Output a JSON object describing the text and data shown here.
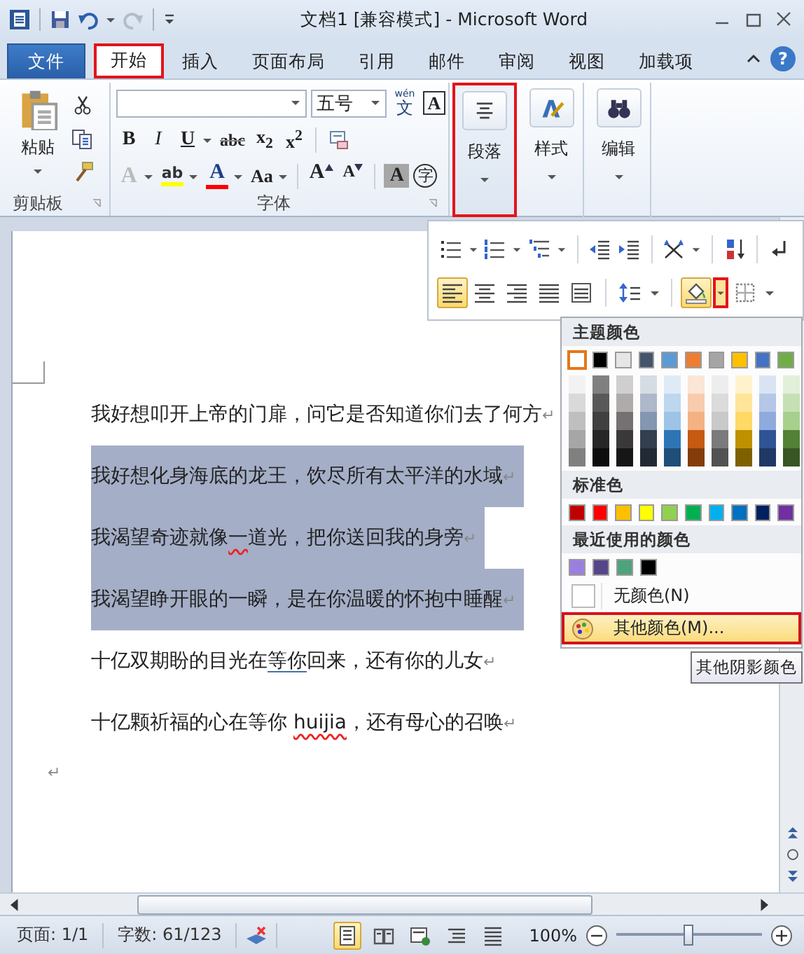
{
  "title_bar": {
    "title": "文档1 [兼容模式] - Microsoft Word",
    "redo_disabled": true
  },
  "tabs": [
    {
      "label": "文件",
      "kind": "file",
      "selected": false,
      "highlighted": false
    },
    {
      "label": "开始",
      "kind": "tab",
      "selected": true,
      "highlighted": true
    },
    {
      "label": "插入",
      "kind": "tab",
      "selected": false,
      "highlighted": false
    },
    {
      "label": "页面布局",
      "kind": "tab",
      "selected": false,
      "highlighted": false
    },
    {
      "label": "引用",
      "kind": "tab",
      "selected": false,
      "highlighted": false
    },
    {
      "label": "邮件",
      "kind": "tab",
      "selected": false,
      "highlighted": false
    },
    {
      "label": "审阅",
      "kind": "tab",
      "selected": false,
      "highlighted": false
    },
    {
      "label": "视图",
      "kind": "tab",
      "selected": false,
      "highlighted": false
    },
    {
      "label": "加载项",
      "kind": "tab",
      "selected": false,
      "highlighted": false
    }
  ],
  "help": "?",
  "ribbon": {
    "clipboard": {
      "paste_label": "粘贴",
      "group_label": "剪贴板"
    },
    "font": {
      "font_size": "五号",
      "phonetic_ruby": "wén",
      "phonetic_char": "文",
      "border_char": "A",
      "group_label": "字体",
      "format_buttons": [
        {
          "label": "B",
          "kind": "bold"
        },
        {
          "label": "I",
          "kind": "italic"
        },
        {
          "label": "U",
          "kind": "underline",
          "dropdown": true
        },
        {
          "label": "abc",
          "kind": "strikethrough"
        },
        {
          "label": "x$_{2}$",
          "kind": "subscript"
        },
        {
          "label": "x$^{2}$",
          "kind": "superscript"
        },
        {
          "kind": "separator"
        },
        {
          "kind": "clear-format"
        }
      ],
      "style_buttons": [
        {
          "label": "A",
          "kind": "text-effects",
          "dropdown": true
        },
        {
          "label": "ab",
          "kind": "highlight",
          "dropdown": true,
          "color": "#ffff00"
        },
        {
          "label": "A",
          "kind": "font-color",
          "dropdown": true,
          "color": "#ff0000"
        },
        {
          "label": "Aa",
          "kind": "change-case",
          "dropdown": true
        },
        {
          "kind": "separator"
        },
        {
          "label": "A",
          "kind": "grow-font"
        },
        {
          "label": "A",
          "kind": "shrink-font"
        },
        {
          "kind": "separator"
        },
        {
          "label": "A",
          "kind": "char-shading"
        },
        {
          "label": "字",
          "kind": "enclose"
        }
      ]
    },
    "groups": [
      {
        "label": "段落",
        "kind": "paragraph",
        "highlighted": true
      },
      {
        "label": "样式",
        "kind": "styles",
        "highlighted": false
      },
      {
        "label": "编辑",
        "kind": "editing",
        "highlighted": false
      }
    ]
  },
  "paragraph_panel": {
    "rows": [
      [
        {
          "kind": "bullets",
          "dropdown": true,
          "selected": false
        },
        {
          "kind": "numbering",
          "dropdown": true,
          "selected": false
        },
        {
          "kind": "multilevel",
          "dropdown": true,
          "selected": false
        },
        {
          "kind": "separator"
        },
        {
          "kind": "decrease-indent",
          "selected": false
        },
        {
          "kind": "increase-indent",
          "selected": false
        },
        {
          "kind": "separator"
        },
        {
          "kind": "asian-layout",
          "dropdown": true,
          "selected": false
        },
        {
          "kind": "separator"
        },
        {
          "kind": "sort",
          "selected": false
        },
        {
          "kind": "separator"
        },
        {
          "kind": "show-marks",
          "selected": false
        }
      ],
      [
        {
          "kind": "align-left",
          "selected": true
        },
        {
          "kind": "align-center",
          "selected": false
        },
        {
          "kind": "align-right",
          "selected": false
        },
        {
          "kind": "justify",
          "selected": false
        },
        {
          "kind": "distributed",
          "selected": false
        },
        {
          "kind": "separator"
        },
        {
          "kind": "line-spacing",
          "dropdown": true,
          "selected": false
        },
        {
          "kind": "separator"
        },
        {
          "kind": "shading",
          "dropdown": true,
          "selected": true,
          "dropdown_highlighted": true
        },
        {
          "kind": "borders",
          "dropdown": true,
          "selected": false
        }
      ]
    ]
  },
  "color_menu": {
    "theme_title": "主题颜色",
    "theme_colors": [
      {
        "color": "#ffffff",
        "selected": true,
        "shades": [
          {
            "color": "#f2f2f2"
          },
          {
            "color": "#d9d9d9"
          },
          {
            "color": "#bfbfbf"
          },
          {
            "color": "#a6a6a6"
          },
          {
            "color": "#808080"
          }
        ]
      },
      {
        "color": "#000000",
        "selected": false,
        "shades": [
          {
            "color": "#808080"
          },
          {
            "color": "#595959"
          },
          {
            "color": "#404040"
          },
          {
            "color": "#262626"
          },
          {
            "color": "#0d0d0d"
          }
        ]
      },
      {
        "color": "#e7e6e6",
        "selected": false,
        "shades": [
          {
            "color": "#d0cece"
          },
          {
            "color": "#aeabab"
          },
          {
            "color": "#757171"
          },
          {
            "color": "#3a3838"
          },
          {
            "color": "#171616"
          }
        ]
      },
      {
        "color": "#44546a",
        "selected": false,
        "shades": [
          {
            "color": "#d6dce4"
          },
          {
            "color": "#adb9ca"
          },
          {
            "color": "#8496b0"
          },
          {
            "color": "#333f4f"
          },
          {
            "color": "#222a35"
          }
        ]
      },
      {
        "color": "#5b9bd5",
        "selected": false,
        "shades": [
          {
            "color": "#deebf6"
          },
          {
            "color": "#bdd7ee"
          },
          {
            "color": "#9dc3e6"
          },
          {
            "color": "#2e75b5"
          },
          {
            "color": "#1f4e79"
          }
        ]
      },
      {
        "color": "#ed7d31",
        "selected": false,
        "shades": [
          {
            "color": "#fbe5d5"
          },
          {
            "color": "#f7cbac"
          },
          {
            "color": "#f4b183"
          },
          {
            "color": "#c55a11"
          },
          {
            "color": "#843c0b"
          }
        ]
      },
      {
        "color": "#a5a5a5",
        "selected": false,
        "shades": [
          {
            "color": "#ededed"
          },
          {
            "color": "#dbdbdb"
          },
          {
            "color": "#c9c9c9"
          },
          {
            "color": "#7b7b7b"
          },
          {
            "color": "#525252"
          }
        ]
      },
      {
        "color": "#ffc000",
        "selected": false,
        "shades": [
          {
            "color": "#fff2cc"
          },
          {
            "color": "#fee599"
          },
          {
            "color": "#ffd965"
          },
          {
            "color": "#bf9000"
          },
          {
            "color": "#7f6000"
          }
        ]
      },
      {
        "color": "#4472c4",
        "selected": false,
        "shades": [
          {
            "color": "#dae3f3"
          },
          {
            "color": "#b4c7e7"
          },
          {
            "color": "#8faadc"
          },
          {
            "color": "#2f5496"
          },
          {
            "color": "#203864"
          }
        ]
      },
      {
        "color": "#70ad47",
        "selected": false,
        "shades": [
          {
            "color": "#e2efd9"
          },
          {
            "color": "#c5e0b3"
          },
          {
            "color": "#a8d08d"
          },
          {
            "color": "#538135"
          },
          {
            "color": "#375623"
          }
        ]
      }
    ],
    "standard_title": "标准色",
    "standard_colors": [
      {
        "color": "#c00000",
        "selected": false
      },
      {
        "color": "#ff0000",
        "selected": false
      },
      {
        "color": "#ffc000",
        "selected": false
      },
      {
        "color": "#ffff00",
        "selected": false
      },
      {
        "color": "#92d050",
        "selected": false
      },
      {
        "color": "#00b050",
        "selected": false
      },
      {
        "color": "#00b0f0",
        "selected": false
      },
      {
        "color": "#0070c0",
        "selected": false
      },
      {
        "color": "#002060",
        "selected": false
      },
      {
        "color": "#7030a0",
        "selected": false
      }
    ],
    "recent_title": "最近使用的颜色",
    "recent_colors": [
      {
        "color": "#9b7fe0",
        "selected": false
      },
      {
        "color": "#55468a",
        "selected": false
      },
      {
        "color": "#4ea37c",
        "selected": false
      },
      {
        "color": "#000000",
        "selected": false
      }
    ],
    "items": [
      {
        "label": "无颜色(N)",
        "kind": "no-color",
        "highlighted": false
      },
      {
        "label": "其他颜色(M)...",
        "kind": "more-colors",
        "highlighted": true
      }
    ],
    "tooltip": "其他阴影颜色"
  },
  "document": {
    "paragraphs": [
      {
        "kind": "body",
        "shaded": false,
        "segments": [
          {
            "text": "我好想叩开上帝的门扉，问它是否知道你们去了何方",
            "kind": "text"
          },
          {
            "text": "↵",
            "kind": "mark"
          }
        ]
      },
      {
        "kind": "body",
        "shaded": true,
        "segments": [
          {
            "text": "我好想化身海底的龙王，饮尽所有太平洋的水域",
            "kind": "text"
          },
          {
            "text": "↵",
            "kind": "mark"
          }
        ]
      },
      {
        "kind": "body",
        "shaded": true,
        "segments": [
          {
            "text": "我渴望奇迹就像",
            "kind": "text"
          },
          {
            "text": "一",
            "kind": "spelling"
          },
          {
            "text": "道光，把你送回我的身旁",
            "kind": "text"
          },
          {
            "text": "↵",
            "kind": "mark"
          }
        ]
      },
      {
        "kind": "body",
        "shaded": true,
        "segments": [
          {
            "text": "我渴望睁开眼的一瞬，是在你温暖的怀抱中睡醒",
            "kind": "text"
          },
          {
            "text": "↵",
            "kind": "mark"
          }
        ]
      },
      {
        "kind": "body",
        "shaded": false,
        "segments": [
          {
            "text": "十亿双期盼的目光在",
            "kind": "text"
          },
          {
            "text": "等你",
            "kind": "grammar"
          },
          {
            "text": "回来，还有你的儿女",
            "kind": "text"
          },
          {
            "text": "↵",
            "kind": "mark"
          }
        ]
      },
      {
        "kind": "body",
        "shaded": false,
        "segments": [
          {
            "text": "十亿颗祈福的心在等你 ",
            "kind": "text"
          },
          {
            "text": "huijia",
            "kind": "spelling"
          },
          {
            "text": "，还有母心的召唤",
            "kind": "text"
          },
          {
            "text": "↵",
            "kind": "mark"
          }
        ]
      },
      {
        "kind": "end",
        "shaded": false,
        "segments": [
          {
            "text": "↵",
            "kind": "mark"
          }
        ]
      }
    ]
  },
  "status_bar": {
    "page": "页面: 1/1",
    "words": "字数: 61/123",
    "views": [
      {
        "kind": "print-layout",
        "selected": true
      },
      {
        "kind": "reading",
        "selected": false
      },
      {
        "kind": "web",
        "selected": false
      },
      {
        "kind": "outline",
        "selected": false
      },
      {
        "kind": "draft",
        "selected": false
      }
    ],
    "zoom": "100%",
    "zoom_slider": {
      "level": 0.5
    }
  }
}
